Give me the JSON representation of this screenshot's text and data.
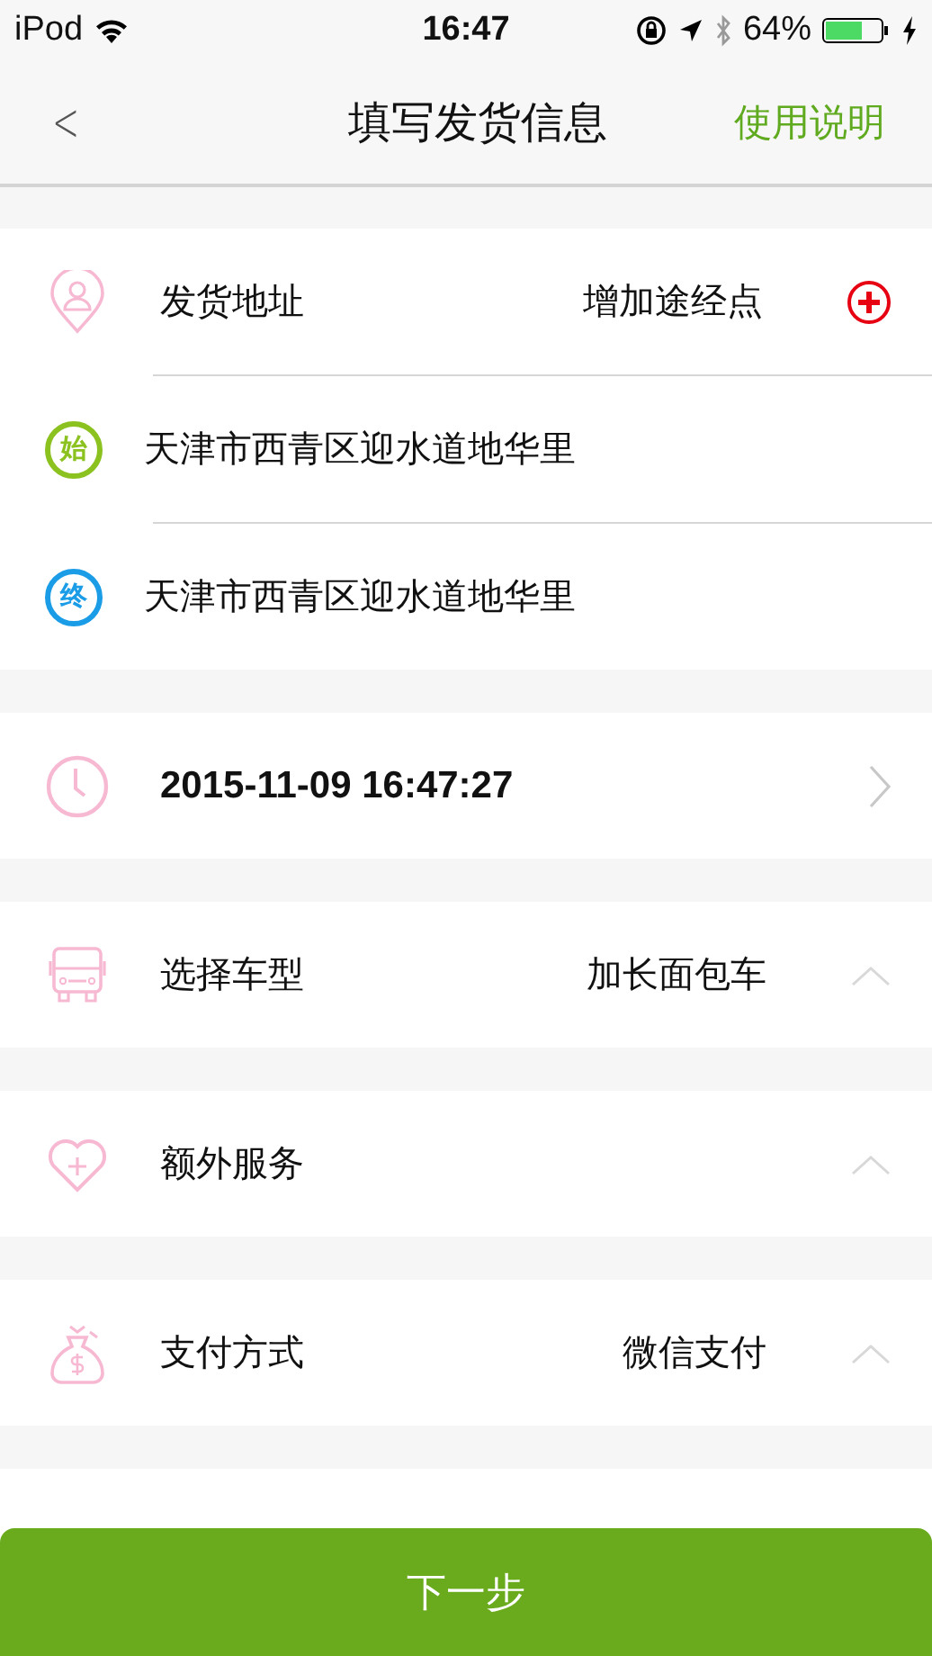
{
  "status_bar": {
    "carrier": "iPod",
    "time": "16:47",
    "battery_text": "64%"
  },
  "nav": {
    "back": "<",
    "title": "填写发货信息",
    "action": "使用说明"
  },
  "address": {
    "label": "发货地址",
    "action": "增加途经点",
    "stops": [
      {
        "badge": "始",
        "color": "#8cc220",
        "text": "天津市西青区迎水道地华里"
      },
      {
        "badge": "终",
        "color": "#1a9ce6",
        "text": "天津市西青区迎水道地华里"
      }
    ]
  },
  "rows": [
    {
      "kind": "link",
      "label": "2015-11-09 16:47:27"
    },
    {
      "kind": "dropdown",
      "label": "选择车型",
      "value": "加长面包车"
    },
    {
      "kind": "dropdown",
      "label": "额外服务"
    },
    {
      "kind": "dropdown",
      "label": "支付方式",
      "value": "微信支付"
    }
  ],
  "next_button": "下一步"
}
